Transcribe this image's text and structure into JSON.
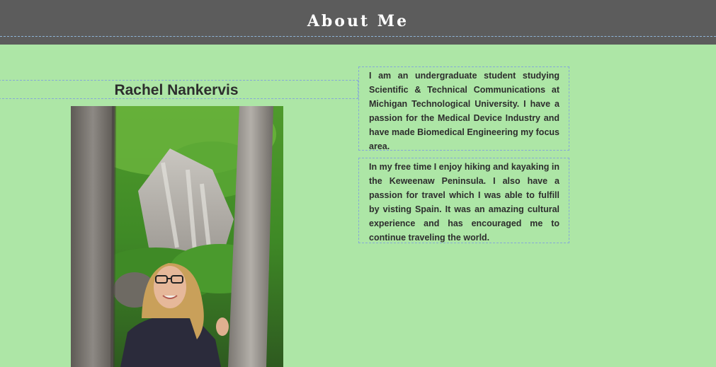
{
  "header": {
    "title": "About Me"
  },
  "profile": {
    "name": "Rachel Nankervis"
  },
  "bio": {
    "paragraph_1": "I am an undergraduate student studying Scientific & Technical Communications at Michigan Technological University. I have a passion for the Medical Device Industry and have made Biomedical Engineering my focus area.",
    "paragraph_2": "In my free time I enjoy hiking and kayaking in the Keweenaw Peninsula. I also have a passion for travel which I was able to fulfill by visting Spain. It was an amazing cultural experience and has encouraged me to continue traveling the world."
  },
  "colors": {
    "page_background": "#ade6a6",
    "header_background": "#5c5c5c",
    "header_text": "#ffffff",
    "body_text": "#2d2d2d",
    "dashed_border": "#86a9d6"
  }
}
